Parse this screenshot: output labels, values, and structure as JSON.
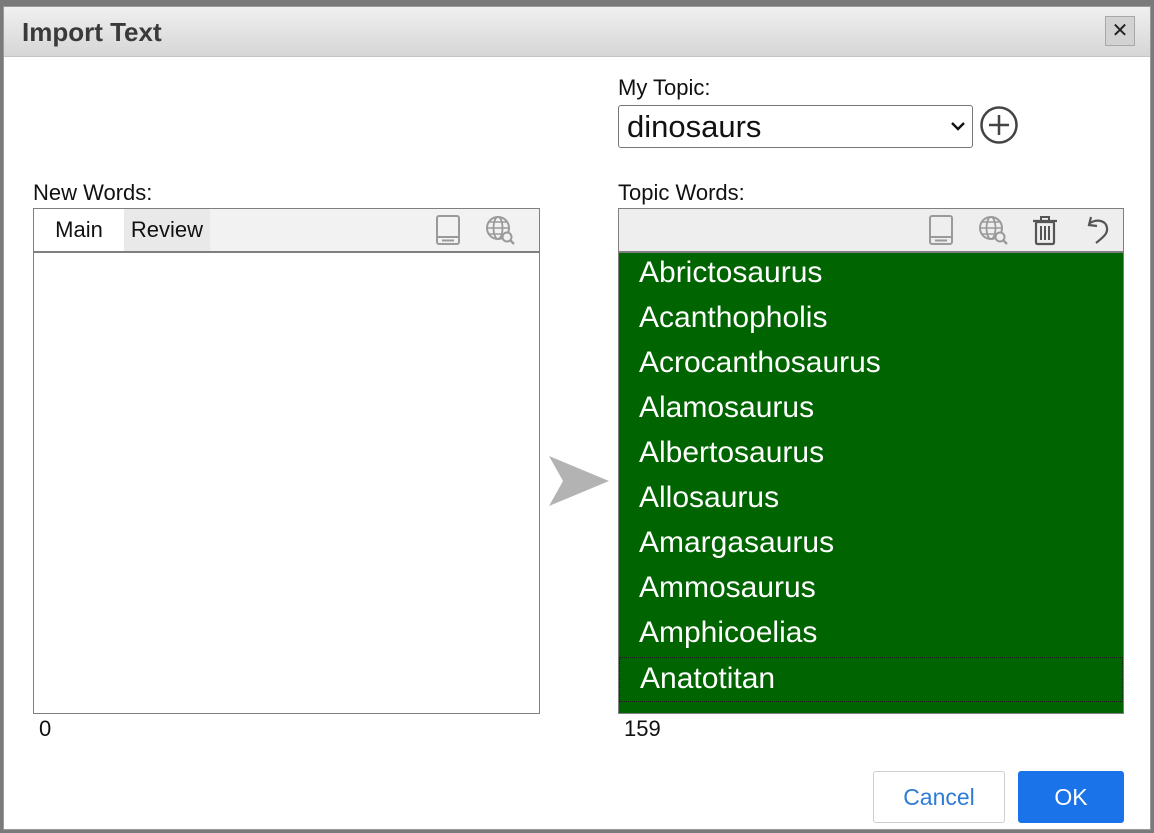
{
  "dialog": {
    "title": "Import Text",
    "close_label": "✕"
  },
  "topic": {
    "label": "My Topic:",
    "selected": "dinosaurs"
  },
  "new_words": {
    "label": "New Words:",
    "tabs": [
      "Main",
      "Review"
    ],
    "count": "0"
  },
  "topic_words": {
    "label": "Topic Words:",
    "items": [
      "Abrictosaurus",
      "Acanthopholis",
      "Acrocanthosaurus",
      "Alamosaurus",
      "Albertosaurus",
      "Allosaurus",
      "Amargasaurus",
      "Ammosaurus",
      "Amphicoelias",
      "Anatotitan"
    ],
    "count": "159"
  },
  "buttons": {
    "cancel": "Cancel",
    "ok": "OK"
  },
  "colors": {
    "list_bg": "#006400",
    "ok_bg": "#1a73e8",
    "cancel_text": "#2e7bd6"
  }
}
